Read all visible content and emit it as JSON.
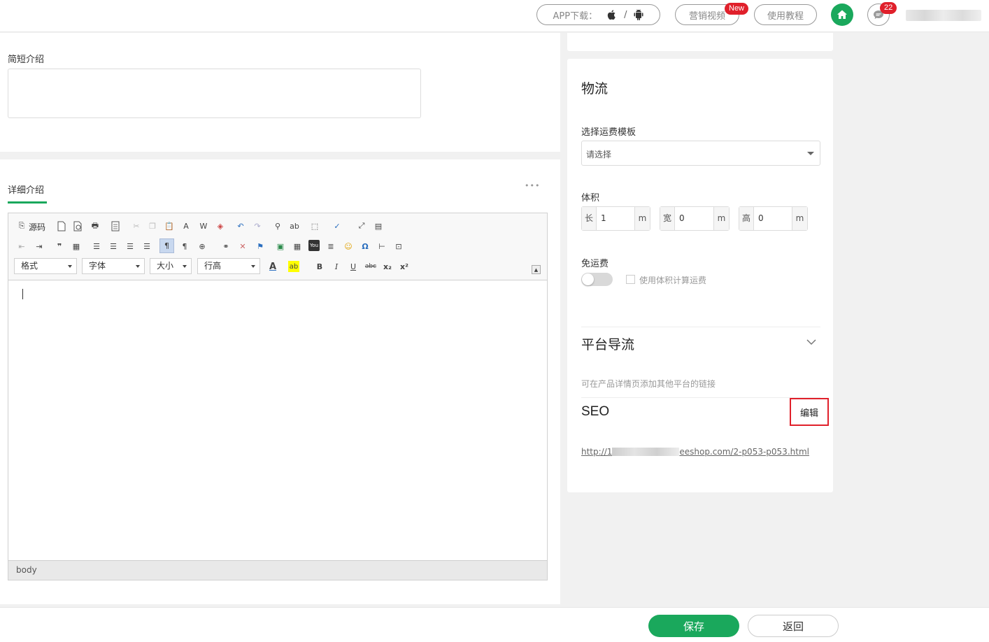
{
  "header": {
    "app_download_label": "APP下载：",
    "app_sep": "/",
    "marketing_video_label": "营销视频",
    "new_badge": "New",
    "tutorial_label": "使用教程",
    "message_count": "22"
  },
  "left": {
    "short_intro_label": "简短介绍",
    "short_intro_value": "",
    "detail_tab_label": "详细介绍",
    "more_label": "•••",
    "editor": {
      "source_label": "源码",
      "format_combo": "格式",
      "font_combo": "字体",
      "size_combo": "大小",
      "lineheight_combo": "行高",
      "status_path": "body"
    }
  },
  "logistics": {
    "section_title": "物流",
    "template_label": "选择运费模板",
    "template_value": "请选择",
    "volume_label": "体积",
    "length_prefix": "长",
    "length_value": "1",
    "length_unit": "m",
    "width_prefix": "宽",
    "width_value": "0",
    "width_unit": "m",
    "height_prefix": "高",
    "height_value": "0",
    "height_unit": "m",
    "free_shipping_label": "免运费",
    "free_shipping_on": false,
    "volume_calc_label": "使用体积计算运费"
  },
  "platform": {
    "title": "平台导流",
    "description": "可在产品详情页添加其他平台的链接"
  },
  "seo": {
    "title": "SEO",
    "edit_label": "编辑",
    "url_prefix": "http://1",
    "url_suffix": "eeshop.com/2-p053-p053.html"
  },
  "footer": {
    "save_label": "保存",
    "back_label": "返回"
  },
  "colors": {
    "primary": "#1aa85c",
    "badge": "#e0202b",
    "highlight_border": "#e0202b"
  }
}
